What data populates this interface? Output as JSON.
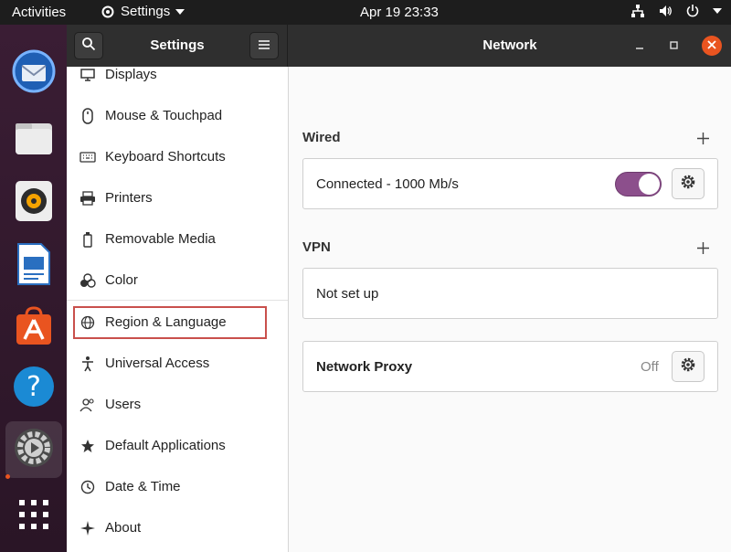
{
  "topbar": {
    "activities": "Activities",
    "app_menu": "Settings",
    "clock": "Apr 19  23:33"
  },
  "dock": {
    "items": [
      "thunderbird-icon",
      "files-icon",
      "rhythmbox-icon",
      "writer-icon",
      "software-icon",
      "help-icon",
      "settings-icon",
      "app-grid-icon"
    ]
  },
  "window": {
    "sidebar_title": "Settings",
    "page_title": "Network"
  },
  "sidebar": {
    "items": [
      {
        "label": "Displays",
        "icon": "display-icon"
      },
      {
        "label": "Mouse & Touchpad",
        "icon": "mouse-icon"
      },
      {
        "label": "Keyboard Shortcuts",
        "icon": "keyboard-icon"
      },
      {
        "label": "Printers",
        "icon": "printer-icon"
      },
      {
        "label": "Removable Media",
        "icon": "usb-icon"
      },
      {
        "label": "Color",
        "icon": "color-icon"
      },
      {
        "label": "Region & Language",
        "icon": "globe-icon"
      },
      {
        "label": "Universal Access",
        "icon": "accessibility-icon"
      },
      {
        "label": "Users",
        "icon": "users-icon"
      },
      {
        "label": "Default Applications",
        "icon": "star-icon"
      },
      {
        "label": "Date & Time",
        "icon": "clock-icon"
      },
      {
        "label": "About",
        "icon": "sparkle-icon"
      }
    ]
  },
  "network": {
    "wired": {
      "title": "Wired",
      "status": "Connected - 1000 Mb/s",
      "enabled": true
    },
    "vpn": {
      "title": "VPN",
      "status": "Not set up"
    },
    "proxy": {
      "title": "Network Proxy",
      "state": "Off"
    }
  },
  "colors": {
    "accent": "#e95420",
    "toggle_on": "#8c4f8c",
    "highlight_box": "#c9504c"
  }
}
